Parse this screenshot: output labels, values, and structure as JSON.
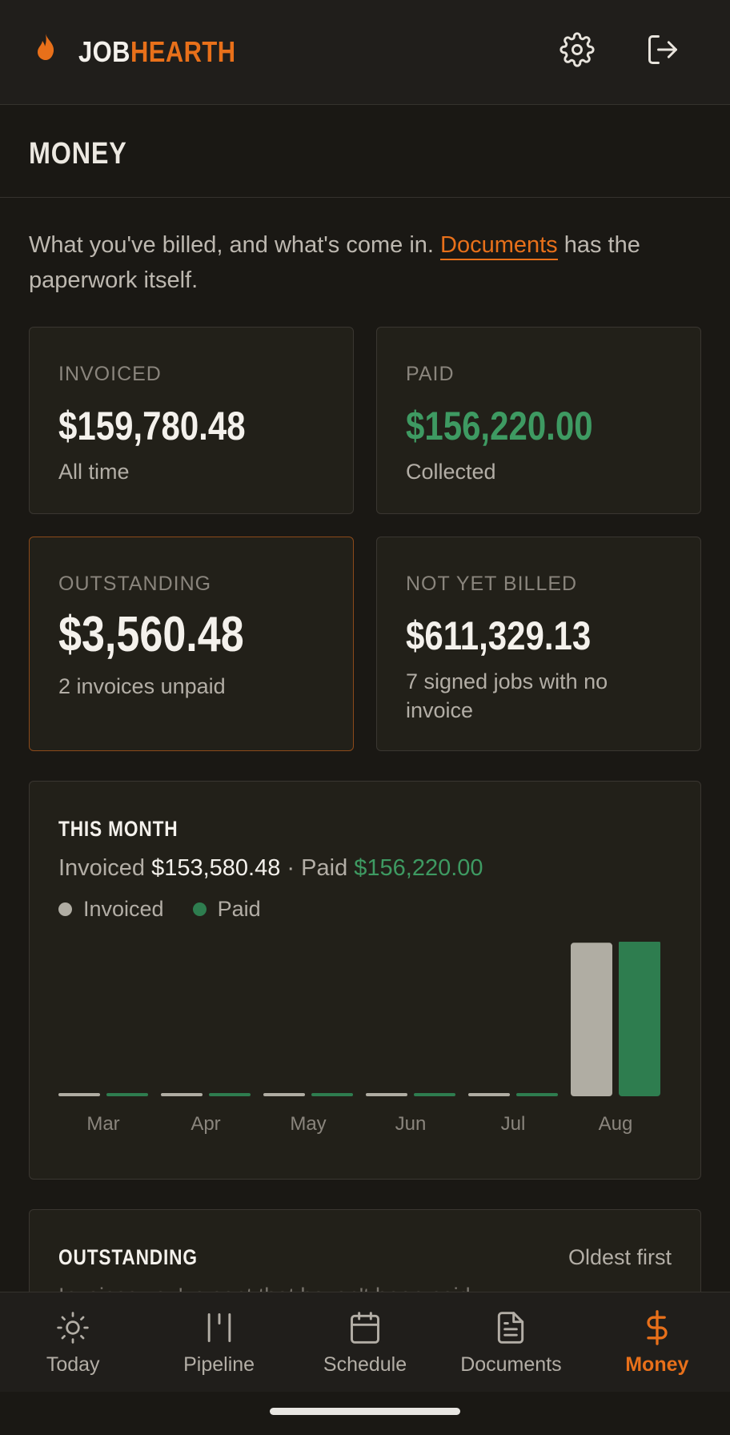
{
  "app": {
    "logo_part1": "JOB",
    "logo_part2": "HEARTH",
    "brand_color": "#e8701a"
  },
  "header": {
    "settings_icon": "gear-icon",
    "logout_icon": "logout-icon"
  },
  "page": {
    "title": "MONEY",
    "intro_before": "What you've billed, and what's come in. ",
    "intro_link": "Documents",
    "intro_after": " has the paperwork itself."
  },
  "stats": {
    "invoiced": {
      "label": "INVOICED",
      "value": "$159,780.48",
      "sub": "All time"
    },
    "paid": {
      "label": "PAID",
      "value": "$156,220.00",
      "sub": "Collected"
    },
    "outstanding": {
      "label": "OUTSTANDING",
      "value": "$3,560.48",
      "sub": "2 invoices unpaid"
    },
    "not_billed": {
      "label": "NOT YET BILLED",
      "value": "$611,329.13",
      "sub": "7 signed jobs with no invoice"
    }
  },
  "this_month": {
    "title": "THIS MONTH",
    "invoiced_label": "Invoiced",
    "invoiced_value": "$153,580.48",
    "separator": "·",
    "paid_label": "Paid",
    "paid_value": "$156,220.00",
    "legend_invoiced": "Invoiced",
    "legend_paid": "Paid"
  },
  "chart_data": {
    "type": "bar",
    "categories": [
      "Mar",
      "Apr",
      "May",
      "Jun",
      "Jul",
      "Aug"
    ],
    "series": [
      {
        "name": "Invoiced",
        "color": "#b0ada3",
        "values": [
          0,
          0,
          0,
          0,
          0,
          153580.48
        ]
      },
      {
        "name": "Paid",
        "color": "#2e7d4f",
        "values": [
          0,
          0,
          0,
          0,
          0,
          156220.0
        ]
      }
    ],
    "ylim": [
      0,
      156220.0
    ],
    "grid": false,
    "legend": "top-left"
  },
  "outstanding_section": {
    "title": "OUTSTANDING",
    "sort_label": "Oldest first",
    "description": "Invoices you've sent that haven't been paid."
  },
  "nav": {
    "items": [
      {
        "label": "Today",
        "icon": "sun-icon"
      },
      {
        "label": "Pipeline",
        "icon": "pipeline-icon"
      },
      {
        "label": "Schedule",
        "icon": "calendar-icon"
      },
      {
        "label": "Documents",
        "icon": "document-icon"
      },
      {
        "label": "Money",
        "icon": "dollar-icon",
        "active": true
      }
    ]
  }
}
